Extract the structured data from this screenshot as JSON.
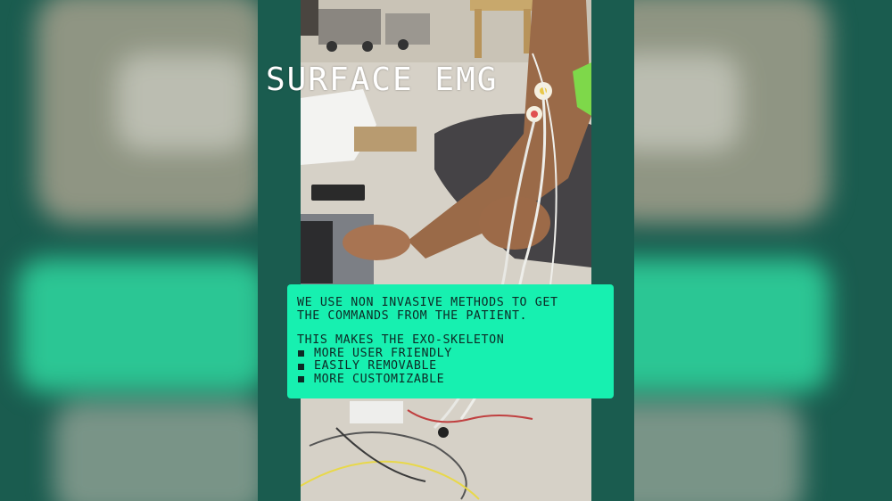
{
  "slide": {
    "title": "SURFACE EMG",
    "intro_line_1": "WE USE NON INVASIVE METHODS TO GET",
    "intro_line_2": "THE COMMANDS FROM THE PATIENT.",
    "makes_line": "THIS MAKES THE EXO-SKELETON",
    "benefits": [
      "MORE USER FRIENDLY",
      "EASILY REMOVABLE",
      "MORE CUSTOMIZABLE"
    ]
  },
  "colors": {
    "frame": "#1a5c4f",
    "card": "#17f0b0",
    "card_text": "#0d2a26",
    "title_text": "#ffffff"
  },
  "icons": {
    "bullet": "square-bullet-icon"
  }
}
